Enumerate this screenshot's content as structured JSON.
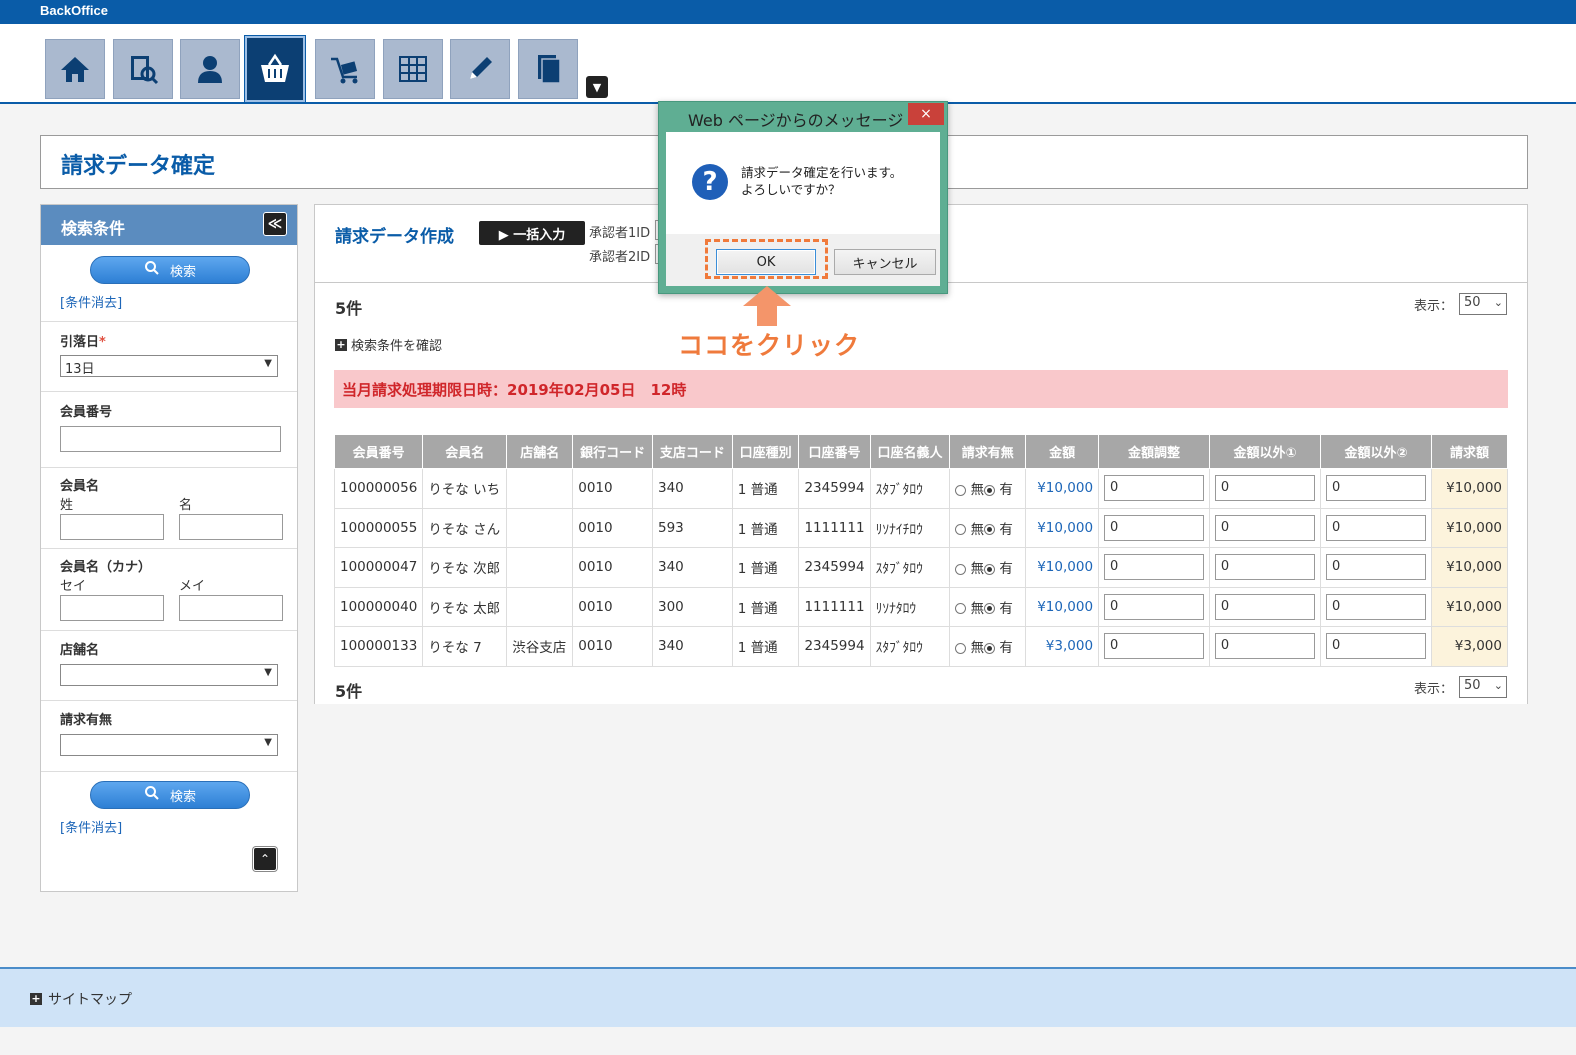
{
  "app": {
    "brand": "BackOffice"
  },
  "nav": {
    "items": [
      {
        "name": "home-icon"
      },
      {
        "name": "member-search-icon"
      },
      {
        "name": "user-icon"
      },
      {
        "name": "basket-icon"
      },
      {
        "name": "cart-icon"
      },
      {
        "name": "grid-icon"
      },
      {
        "name": "pencil-icon"
      },
      {
        "name": "documents-icon"
      }
    ],
    "more": "▼"
  },
  "page": {
    "title": "請求データ確定"
  },
  "sidebar": {
    "title": "検索条件",
    "collapse": "≪",
    "search_label": "検索",
    "clear_label": "[条件消去]",
    "withdraw_day": {
      "label": "引落日",
      "required": "*",
      "value": "13日"
    },
    "member_no": {
      "label": "会員番号"
    },
    "member_name": {
      "label": "会員名",
      "last": "姓",
      "first": "名"
    },
    "member_kana": {
      "label": "会員名（カナ）",
      "last": "セイ",
      "first": "メイ"
    },
    "store": {
      "label": "店舗名",
      "value": ""
    },
    "billing": {
      "label": "請求有無",
      "value": ""
    },
    "scroll_top": "⌃"
  },
  "main": {
    "title": "請求データ作成",
    "bulk_label": "▶ 一括入力",
    "approver1": "承認者1ID",
    "approver2": "承認者2ID",
    "count": "5件",
    "display_label": "表示：",
    "display_value": "50",
    "confirm_link": "検索条件を確認",
    "alert": "当月請求処理期限日時：2019年02月05日　12時",
    "columns": [
      "会員番号",
      "会員名",
      "店舗名",
      "銀行コード",
      "支店コード",
      "口座種別",
      "口座番号",
      "口座名義人",
      "請求有無",
      "金額",
      "金額調整",
      "金額以外①",
      "金額以外②",
      "請求額"
    ],
    "radio_none": "無",
    "radio_yes": "有",
    "rows": [
      {
        "no": "100000056",
        "name": "りそな いち",
        "store": "",
        "bank": "0010",
        "branch": "340",
        "type": "1 普通",
        "account": "2345994",
        "holder": "ｽﾀﾌﾞﾀﾛｳ",
        "amount": "¥10,000",
        "adj": "0",
        "ex1": "0",
        "ex2": "0",
        "bill": "¥10,000"
      },
      {
        "no": "100000055",
        "name": "りそな さん",
        "store": "",
        "bank": "0010",
        "branch": "593",
        "type": "1 普通",
        "account": "1111111",
        "holder": "ﾘｿﾅｲﾁﾛｳ",
        "amount": "¥10,000",
        "adj": "0",
        "ex1": "0",
        "ex2": "0",
        "bill": "¥10,000"
      },
      {
        "no": "100000047",
        "name": "りそな 次郎",
        "store": "",
        "bank": "0010",
        "branch": "340",
        "type": "1 普通",
        "account": "2345994",
        "holder": "ｽﾀﾌﾞﾀﾛｳ",
        "amount": "¥10,000",
        "adj": "0",
        "ex1": "0",
        "ex2": "0",
        "bill": "¥10,000"
      },
      {
        "no": "100000040",
        "name": "りそな 太郎",
        "store": "",
        "bank": "0010",
        "branch": "300",
        "type": "1 普通",
        "account": "1111111",
        "holder": "ﾘｿﾅﾀﾛｳ",
        "amount": "¥10,000",
        "adj": "0",
        "ex1": "0",
        "ex2": "0",
        "bill": "¥10,000"
      },
      {
        "no": "100000133",
        "name": "りそな 7",
        "store": "渋谷支店",
        "bank": "0010",
        "branch": "340",
        "type": "1 普通",
        "account": "2345994",
        "holder": "ｽﾀﾌﾞﾀﾛｳ",
        "amount": "¥3,000",
        "adj": "0",
        "ex1": "0",
        "ex2": "0",
        "bill": "¥3,000"
      }
    ],
    "count_bottom": "5件"
  },
  "footer": {
    "sitemap": "サイトマップ"
  },
  "dialog": {
    "title": "Web ページからのメッセージ",
    "close": "×",
    "line1": "請求データ確定を行います。",
    "line2": "よろしいですか？",
    "ok": "OK",
    "cancel": "キャンセル"
  },
  "annotation": {
    "text": "ココをクリック"
  },
  "colors": {
    "brand": "#0a5ca8",
    "accent": "#ef7a3c",
    "alert_bg": "#f9c8cb",
    "alert_text": "#d0262a"
  }
}
